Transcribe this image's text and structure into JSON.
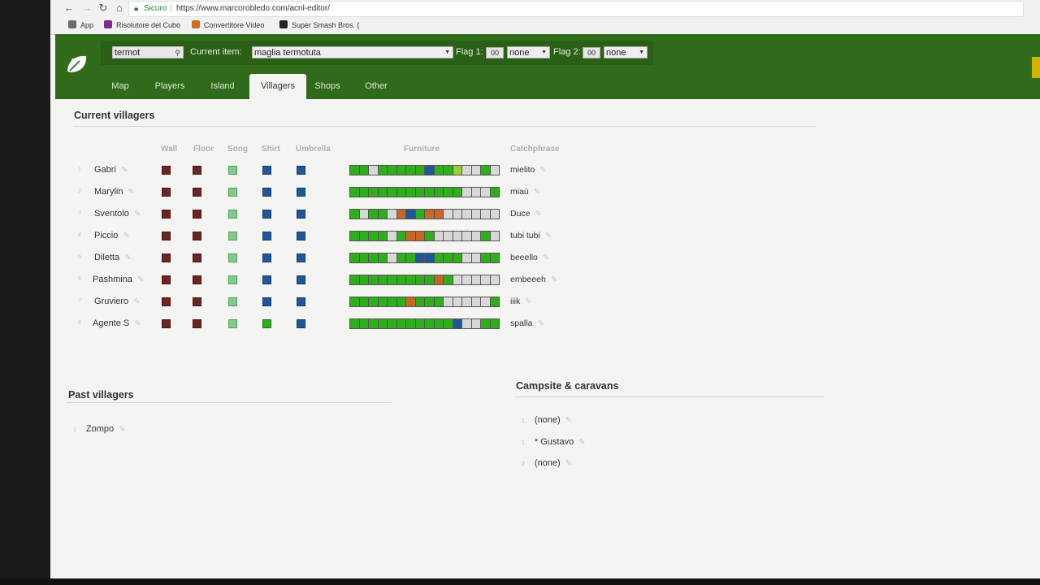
{
  "browser": {
    "secure_label": "Sicuro",
    "url": "https://www.marcorobledo.com/acnl-editor/",
    "bookmarks": [
      {
        "label": "App",
        "icon": "apps-grid-icon",
        "color": "#6a6a6a"
      },
      {
        "label": "Risolutore del Cubo",
        "icon": "cube-icon",
        "color": "#7b2b8c"
      },
      {
        "label": "Convertitore Video",
        "icon": "video-converter-icon",
        "color": "#d2691e"
      },
      {
        "label": "Super Smash Bros. (",
        "icon": "smash-bros-icon",
        "color": "#222222"
      }
    ]
  },
  "header": {
    "search_value": "termot",
    "current_item_label": "Current item:",
    "current_item_value": "maglia termotuta",
    "flag1_label": "Flag 1:",
    "flag1_value": "00",
    "flag1_select": "none",
    "flag2_label": "Flag 2:",
    "flag2_value": "00",
    "flag2_select": "none"
  },
  "tabs": [
    {
      "label": "Map",
      "active": false
    },
    {
      "label": "Players",
      "active": false
    },
    {
      "label": "Island",
      "active": false
    },
    {
      "label": "Villagers",
      "active": true
    },
    {
      "label": "Shops",
      "active": false
    },
    {
      "label": "Other",
      "active": false
    }
  ],
  "current_villagers": {
    "title": "Current villagers",
    "columns": {
      "wall": "Wall",
      "floor": "Floor",
      "song": "Song",
      "shirt": "Shirt",
      "umbrella": "Umbrella",
      "furniture": "Furniture",
      "catchphrase": "Catchphrase"
    },
    "colors": {
      "wall": "#6b2323",
      "song": "#7fc98a",
      "shirt": "#1f5799",
      "green": "#2fae1c",
      "orange": "#c8662a",
      "lime": "#9acd32",
      "gray": "#d8d8d8"
    },
    "rows": [
      {
        "index": "1",
        "name": "Gabri",
        "catchphrase": "mielito",
        "shirt": "blue",
        "furniture": [
          "G",
          "G",
          "Y",
          "G",
          "G",
          "G",
          "G",
          "G",
          "B",
          "G",
          "G",
          "L",
          "Y",
          "Y",
          "G",
          "Y"
        ]
      },
      {
        "index": "2",
        "name": "Marylin",
        "catchphrase": "miaù",
        "shirt": "blue",
        "furniture": [
          "G",
          "G",
          "G",
          "G",
          "G",
          "G",
          "G",
          "G",
          "G",
          "G",
          "G",
          "G",
          "Y",
          "Y",
          "Y",
          "G"
        ]
      },
      {
        "index": "3",
        "name": "Sventolo",
        "catchphrase": "Duce",
        "shirt": "blue",
        "furniture": [
          "G",
          "Y",
          "G",
          "G",
          "Y",
          "O",
          "B",
          "G",
          "O",
          "O",
          "Y",
          "Y",
          "Y",
          "Y",
          "Y",
          "Y"
        ]
      },
      {
        "index": "4",
        "name": "Piccio",
        "catchphrase": "tubi tubi",
        "shirt": "blue",
        "furniture": [
          "G",
          "G",
          "G",
          "G",
          "Y",
          "G",
          "O",
          "O",
          "G",
          "Y",
          "Y",
          "Y",
          "Y",
          "Y",
          "G",
          "Y"
        ]
      },
      {
        "index": "5",
        "name": "Diletta",
        "catchphrase": "beeello",
        "shirt": "blue",
        "furniture": [
          "G",
          "G",
          "G",
          "G",
          "Y",
          "G",
          "G",
          "B",
          "B",
          "G",
          "G",
          "G",
          "Y",
          "Y",
          "G",
          "G"
        ]
      },
      {
        "index": "6",
        "name": "Pashmina",
        "catchphrase": "embeeeh",
        "shirt": "blue",
        "furniture": [
          "G",
          "G",
          "G",
          "G",
          "G",
          "G",
          "G",
          "G",
          "G",
          "O",
          "G",
          "Y",
          "Y",
          "Y",
          "Y",
          "Y"
        ]
      },
      {
        "index": "7",
        "name": "Gruviero",
        "catchphrase": "iiik",
        "shirt": "blue",
        "furniture": [
          "G",
          "G",
          "G",
          "G",
          "G",
          "G",
          "O",
          "G",
          "G",
          "G",
          "Y",
          "Y",
          "Y",
          "Y",
          "Y",
          "G"
        ]
      },
      {
        "index": "8",
        "name": "Agente S",
        "catchphrase": "spalla",
        "shirt": "green",
        "furniture": [
          "G",
          "G",
          "G",
          "G",
          "G",
          "G",
          "G",
          "G",
          "G",
          "G",
          "G",
          "B",
          "Y",
          "Y",
          "G",
          "G"
        ]
      }
    ]
  },
  "past_villagers": {
    "title": "Past villagers",
    "items": [
      {
        "index": "1",
        "name": "Zompo"
      }
    ]
  },
  "campsite": {
    "title": "Campsite & caravans",
    "items": [
      {
        "index": "1",
        "name": "(none)"
      },
      {
        "index": "1",
        "name": "* Gustavo"
      },
      {
        "index": "2",
        "name": "(none)"
      }
    ]
  }
}
